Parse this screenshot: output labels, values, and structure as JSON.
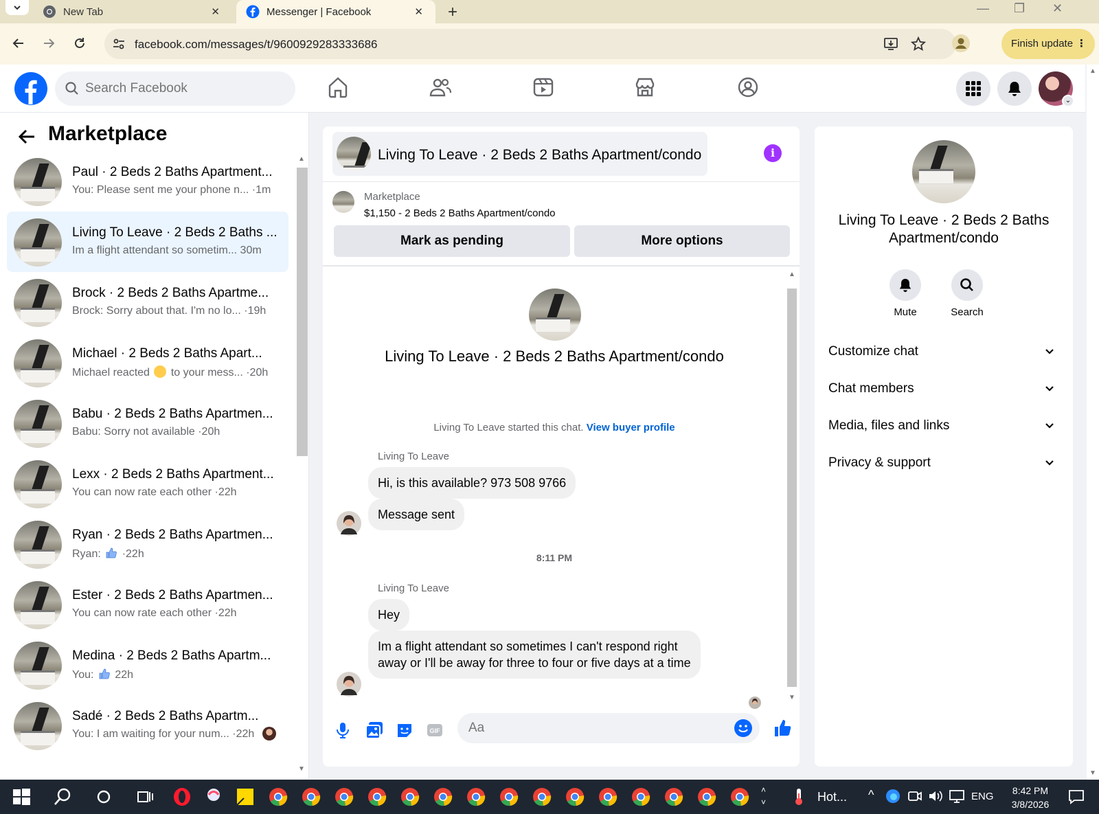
{
  "browser": {
    "tabs": [
      {
        "title": "New Tab",
        "icon": "chrome-icon"
      },
      {
        "title": "Messenger | Facebook",
        "icon": "facebook-icon",
        "active": true
      }
    ],
    "url": "facebook.com/messages/t/9600929283333686",
    "finish_update": "Finish update"
  },
  "fb": {
    "search_placeholder": "Search Facebook",
    "brand_color": "#0866ff"
  },
  "sidebar": {
    "title": "Marketplace",
    "conversations": [
      {
        "name": "Paul · 2 Beds 2 Baths Apartment...",
        "preview": "You: Please sent me your phone n... ·1m"
      },
      {
        "name": "Living To Leave · 2 Beds 2 Baths ...",
        "preview": "Im a flight attendant so sometim...  30m",
        "active": true
      },
      {
        "name": "Brock · 2 Beds 2 Baths Apartme...",
        "preview": "Brock: Sorry about that. I'm no lo... ·19h"
      },
      {
        "name": "Michael · 2 Beds 2 Baths Apart...",
        "preview_pre": "Michael reacted",
        "preview_post": "to your mess... ·20h"
      },
      {
        "name": "Babu · 2 Beds 2 Baths Apartmen...",
        "preview": "Babu: Sorry not available ·20h"
      },
      {
        "name": "Lexx · 2 Beds 2 Baths Apartment...",
        "preview": "You can now rate each other ·22h"
      },
      {
        "name": "Ryan · 2 Beds 2 Baths Apartmen...",
        "preview_pre": "Ryan:",
        "preview_post": "·22h"
      },
      {
        "name": "Ester · 2 Beds 2 Baths Apartmen...",
        "preview": "You can now rate each other ·22h"
      },
      {
        "name": "Medina · 2 Beds 2 Baths Apartm...",
        "preview_pre": "You:",
        "preview_post": "22h"
      },
      {
        "name": "Sadé · 2 Beds 2 Baths Apartm...",
        "preview": "You: I am waiting for your num... ·22h"
      }
    ]
  },
  "chat": {
    "header_title": "Living To Leave · 2 Beds 2 Baths Apartment/condo",
    "marketplace_label": "Marketplace",
    "listing": "$1,150 - 2 Beds 2 Baths Apartment/condo",
    "mark_pending": "Mark as pending",
    "more_options": "More options",
    "intro_title": "Living To Leave · 2 Beds 2 Baths Apartment/condo",
    "started_text": "Living To Leave started this chat.",
    "view_buyer": "View buyer profile",
    "sender1": "Living To Leave",
    "msg1": "Hi, is this available? 973 508 9766",
    "msg2": "Message sent",
    "timestamp": "8:11 PM",
    "sender2": "Living To Leave",
    "msg3": "Hey",
    "msg4": "Im a flight attendant so sometimes I can't respond right away or I'll be away for three to four or five days at a time",
    "composer_placeholder": "Aa"
  },
  "right_panel": {
    "title": "Living To Leave · 2 Beds 2 Baths Apartment/condo",
    "mute": "Mute",
    "search": "Search",
    "sections": [
      "Customize chat",
      "Chat members",
      "Media, files and links",
      "Privacy & support"
    ]
  },
  "taskbar": {
    "weather": "Hot...",
    "lang": "ENG",
    "time": "8:42 PM",
    "date": "3/8/2026"
  }
}
